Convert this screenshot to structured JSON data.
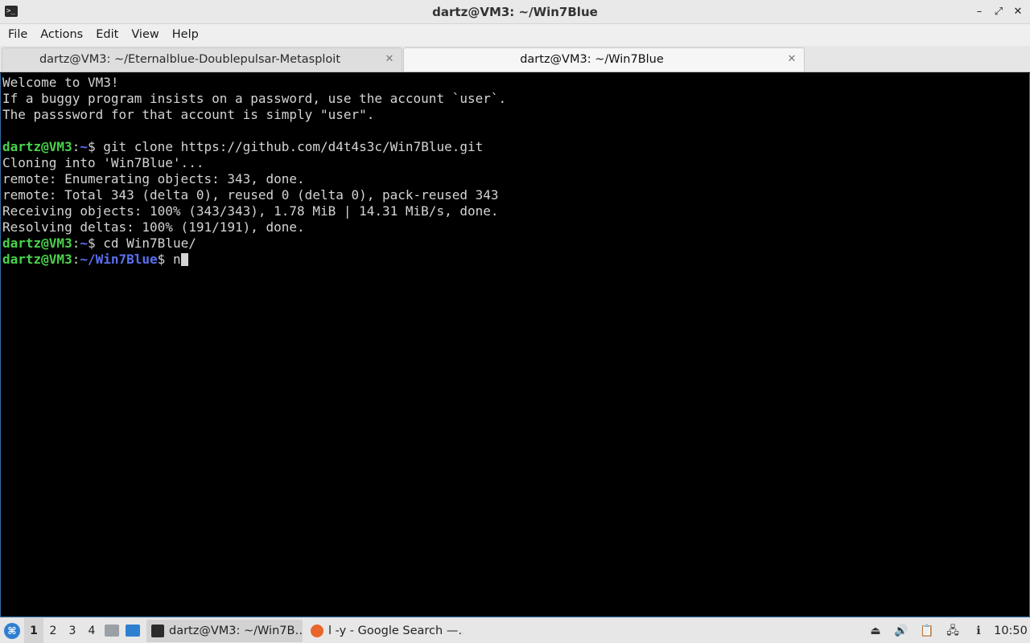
{
  "window": {
    "title": "dartz@VM3: ~/Win7Blue",
    "icon": "terminal-icon",
    "controls": {
      "minimize": "–",
      "restore": "⤢",
      "close": "✕"
    }
  },
  "menu": {
    "items": [
      "File",
      "Actions",
      "Edit",
      "View",
      "Help"
    ]
  },
  "tabs": [
    {
      "label": "dartz@VM3: ~/Eternalblue-Doublepulsar-Metasploit",
      "close": "✕",
      "active": false
    },
    {
      "label": "dartz@VM3: ~/Win7Blue",
      "close": "✕",
      "active": true
    }
  ],
  "terminal": {
    "lines": {
      "l0": "Welcome to VM3!",
      "l1": "If a buggy program insists on a password, use the account `user`.",
      "l2": "The passsword for that account is simply \"user\".",
      "l4_user": "dartz@VM3",
      "l4_colon": ":",
      "l4_path": "~",
      "l4_cmd": "$ git clone https://github.com/d4t4s3c/Win7Blue.git",
      "l5": "Cloning into 'Win7Blue'...",
      "l6": "remote: Enumerating objects: 343, done.",
      "l7": "remote: Total 343 (delta 0), reused 0 (delta 0), pack-reused 343",
      "l8": "Receiving objects: 100% (343/343), 1.78 MiB | 14.31 MiB/s, done.",
      "l9": "Resolving deltas: 100% (191/191), done.",
      "l10_user": "dartz@VM3",
      "l10_colon": ":",
      "l10_path": "~",
      "l10_cmd": "$ cd Win7Blue/",
      "l11_user": "dartz@VM3",
      "l11_colon": ":",
      "l11_path": "~/Win7Blue",
      "l11_cmd": "$ n"
    },
    "colors": {
      "user": "#4ad24a",
      "path": "#5a6ff0",
      "text": "#d4d4d4",
      "background": "#000000"
    }
  },
  "taskbar": {
    "workspaces": [
      "1",
      "2",
      "3",
      "4"
    ],
    "active_workspace": "1",
    "tasks": [
      {
        "label": "dartz@VM3: ~/Win7B…",
        "icon": "terminal-icon",
        "active": true
      },
      {
        "label": "l -y - Google Search —…",
        "icon": "firefox-icon",
        "active": false
      }
    ],
    "clock": "10:50"
  }
}
